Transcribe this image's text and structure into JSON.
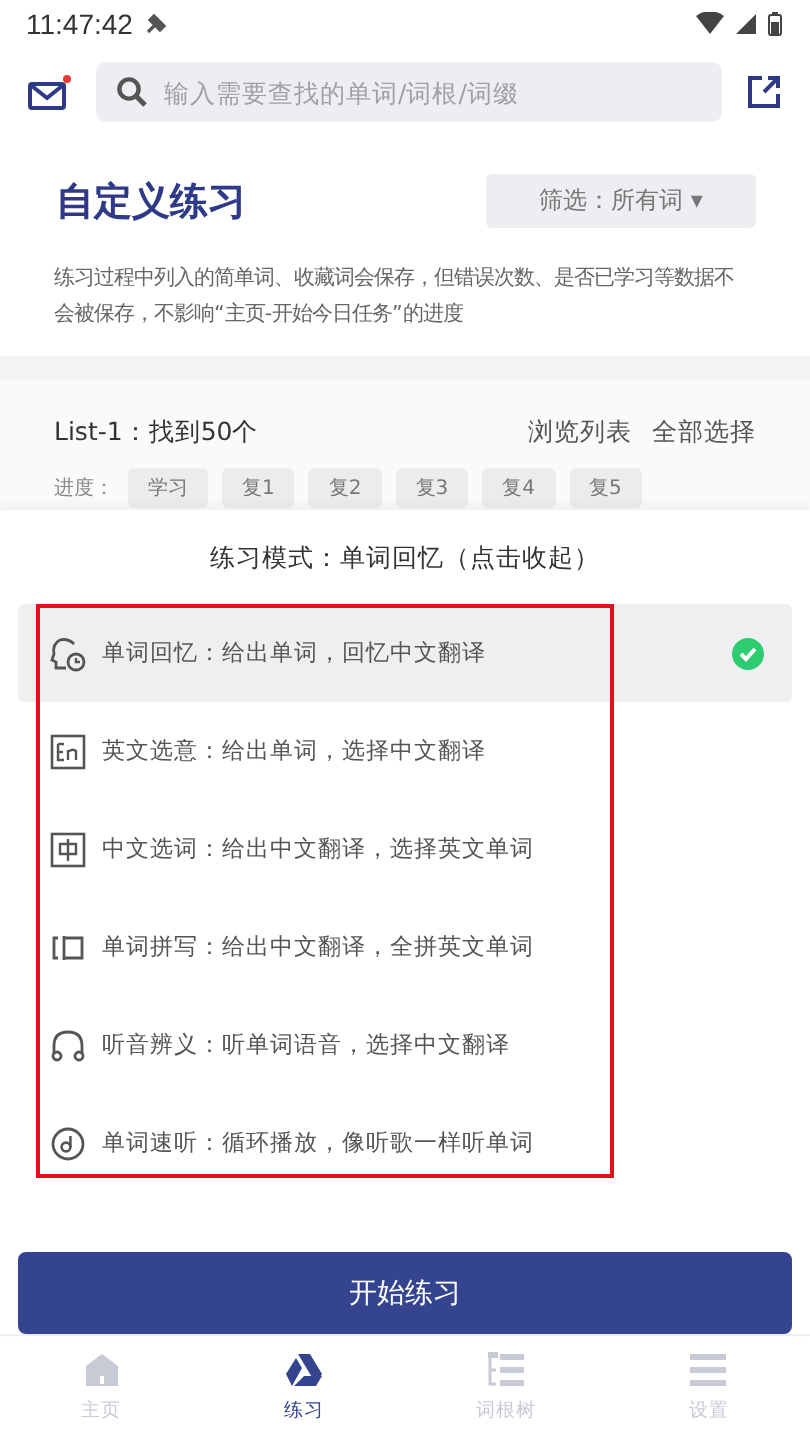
{
  "status_bar": {
    "time": "11:47:42"
  },
  "header": {
    "mail_unread": true,
    "search": {
      "placeholder": "输入需要查找的单词/词根/词缀"
    }
  },
  "title": "自定义练习",
  "filter": {
    "label": "筛选：所有词 ▾"
  },
  "description": "练习过程中列入的简单词、收藏词会保存，但错误次数、是否已学习等数据不会被保存，不影响“主页-开始今日任务”的进度",
  "list_card": {
    "title": "List-1：找到50个",
    "actions": [
      "浏览列表",
      "全部选择"
    ],
    "progress_label": "进度：",
    "chips": [
      "学习",
      "复1",
      "复2",
      "复3",
      "复4",
      "复5"
    ]
  },
  "sheet": {
    "title": "练习模式：单词回忆（点击收起）",
    "highlight_frame": true,
    "modes": [
      {
        "kind": "recall",
        "label": "单词回忆：给出单词，回忆中文翻译",
        "selected": true
      },
      {
        "kind": "en",
        "label": "英文选意：给出单词，选择中文翻译",
        "selected": false
      },
      {
        "kind": "zh",
        "label": "中文选词：给出中文翻译，选择英文单词",
        "selected": false
      },
      {
        "kind": "spell",
        "label": "单词拼写：给出中文翻译，全拼英文单词",
        "selected": false
      },
      {
        "kind": "listen",
        "label": "听音辨义：听单词语音，选择中文翻译",
        "selected": false
      },
      {
        "kind": "music",
        "label": "单词速听：循环播放，像听歌一样听单词",
        "selected": false
      }
    ]
  },
  "start_button": "开始练习",
  "nav": [
    {
      "kind": "home",
      "label": "主页",
      "selected": false
    },
    {
      "kind": "practice",
      "label": "练习",
      "selected": true
    },
    {
      "kind": "tree",
      "label": "词根树",
      "selected": false
    },
    {
      "kind": "settings",
      "label": "设置",
      "selected": false
    }
  ]
}
